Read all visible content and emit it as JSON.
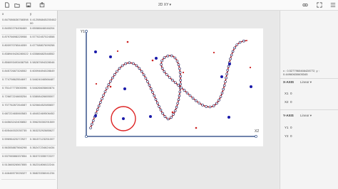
{
  "app": {
    "title": "2D XY"
  },
  "toolbar": {
    "icons": [
      "file-icon",
      "folder-icon",
      "save-icon",
      "export-icon"
    ],
    "right_icons": [
      "link-icon",
      "expand-icon",
      "menu-icon"
    ]
  },
  "table": {
    "headers": [
      "x",
      "y"
    ],
    "rows": [
      [
        "0.847086636766598",
        "0.41208684520046200"
      ],
      [
        "0.84052276496469",
        "0.65086646046204"
      ],
      [
        "0.87976698225958",
        "0.57702457024558"
      ],
      [
        "0.80097076544059",
        "0.67708807699258"
      ],
      [
        "0.838949426280022",
        "0.63586682548552"
      ],
      [
        "0.856093493458758",
        "0.58287694328046"
      ],
      [
        "0.84572687326552",
        "0.60094694028649"
      ],
      [
        "0.77479862554697",
        "0.54624046566487"
      ],
      [
        "0.75147773500096",
        "0.54626605860874"
      ],
      [
        "0.72687224665254",
        "0.53808426655007"
      ],
      [
        "0.70776287264087",
        "0.52066452085657"
      ],
      [
        "0.68722465060583",
        "0.48402469506452"
      ],
      [
        "0.64563242405852",
        "0.39623030291509"
      ],
      [
        "0.60544002030735",
        "0.36323292885627"
      ],
      [
        "0.59696420272927",
        "0.36157123251007"
      ],
      [
        "0.56305887566298",
        "0.36247234624434"
      ],
      [
        "0.53706586337854",
        "0.36372335072227"
      ],
      [
        "0.51366526567855",
        "0.36231806022244"
      ],
      [
        "0.44646573026327",
        "0.36823336041234"
      ]
    ]
  },
  "plot": {
    "y_axis_label": "Y1",
    "x_axis_label": "X2"
  },
  "right_panel": {
    "cursor": "x : 0.5277960466428772, y : 0.44960630605345",
    "x_axis": {
      "heading": "X-AXIS",
      "scale": "Linear",
      "fields": [
        "X1",
        "X2"
      ],
      "values": [
        "0",
        "0"
      ]
    },
    "y_axis": {
      "heading": "Y-AXIS",
      "scale": "Linear",
      "fields": [
        "Y1",
        "Y2"
      ],
      "values": [
        "0",
        "0"
      ]
    }
  }
}
